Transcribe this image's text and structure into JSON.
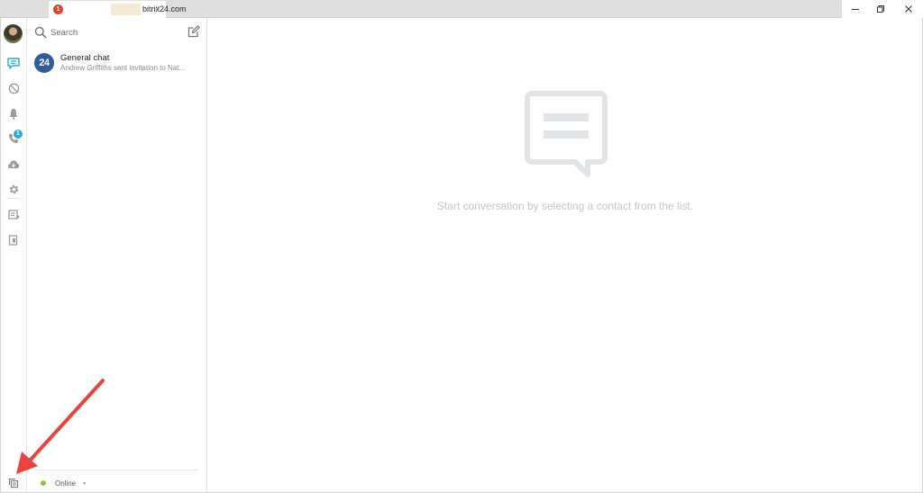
{
  "window": {
    "tab": {
      "badge": "1",
      "title": "bitrix24.com",
      "close": "×"
    }
  },
  "sidebar": {
    "notification_badge": "1",
    "icons": [
      "chat-icon",
      "channels-icon",
      "notifications-icon",
      "phone-icon",
      "disk-icon",
      "settings-icon",
      "tasks-icon",
      "notes-icon",
      "pin-icon"
    ]
  },
  "contacts": {
    "search_placeholder": "Search",
    "chats": [
      {
        "avatar_text": "24",
        "name": "General chat",
        "preview": "Andrew Griffiths sent invitation to Nat..."
      }
    ],
    "status": {
      "label": "Online",
      "caret": "▾"
    }
  },
  "main": {
    "empty_message": "Start conversation by selecting a contact from the list."
  },
  "colors": {
    "accent": "#2fa7d8",
    "tab_badge": "#e3422b",
    "chat_avatar": "#2d5e99",
    "online": "#8ec63f",
    "annotation_arrow": "#e8433f",
    "empty_icon": "#e1e4e6"
  }
}
